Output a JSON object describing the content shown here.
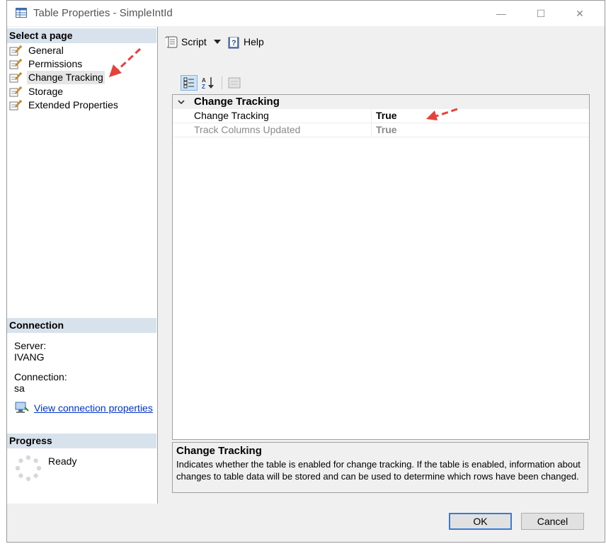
{
  "window": {
    "title": "Table Properties - SimpleIntId",
    "controls": {
      "minimize": "—",
      "maximize": "☐",
      "close": "✕"
    }
  },
  "left_pane": {
    "select_page_header": "Select a page",
    "pages": [
      {
        "label": "General",
        "icon": "page-wrench-icon"
      },
      {
        "label": "Permissions",
        "icon": "page-wrench-icon"
      },
      {
        "label": "Change Tracking",
        "icon": "page-wrench-icon",
        "selected": true
      },
      {
        "label": "Storage",
        "icon": "page-wrench-icon"
      },
      {
        "label": "Extended Properties",
        "icon": "page-wrench-icon"
      }
    ],
    "connection": {
      "header": "Connection",
      "server_label": "Server:",
      "server_value": "IVANG",
      "connection_label": "Connection:",
      "connection_value": "sa",
      "view_link": "View connection properties"
    },
    "progress": {
      "header": "Progress",
      "status": "Ready"
    }
  },
  "toolbar": {
    "script_label": "Script",
    "help_label": "Help"
  },
  "property_grid": {
    "category": "Change Tracking",
    "rows": [
      {
        "name": "Change Tracking",
        "value": "True",
        "enabled": true
      },
      {
        "name": "Track Columns Updated",
        "value": "True",
        "enabled": false
      }
    ]
  },
  "description": {
    "title": "Change Tracking",
    "text": "Indicates whether the table is enabled for change tracking. If the table is enabled, information about changes to table data will be stored and can be used to determine which rows have been changed."
  },
  "buttons": {
    "ok": "OK",
    "cancel": "Cancel"
  },
  "colors": {
    "annotation_arrow": "#e8403a",
    "section_header_bg": "#d8e2ec",
    "link": "#0033cc"
  }
}
